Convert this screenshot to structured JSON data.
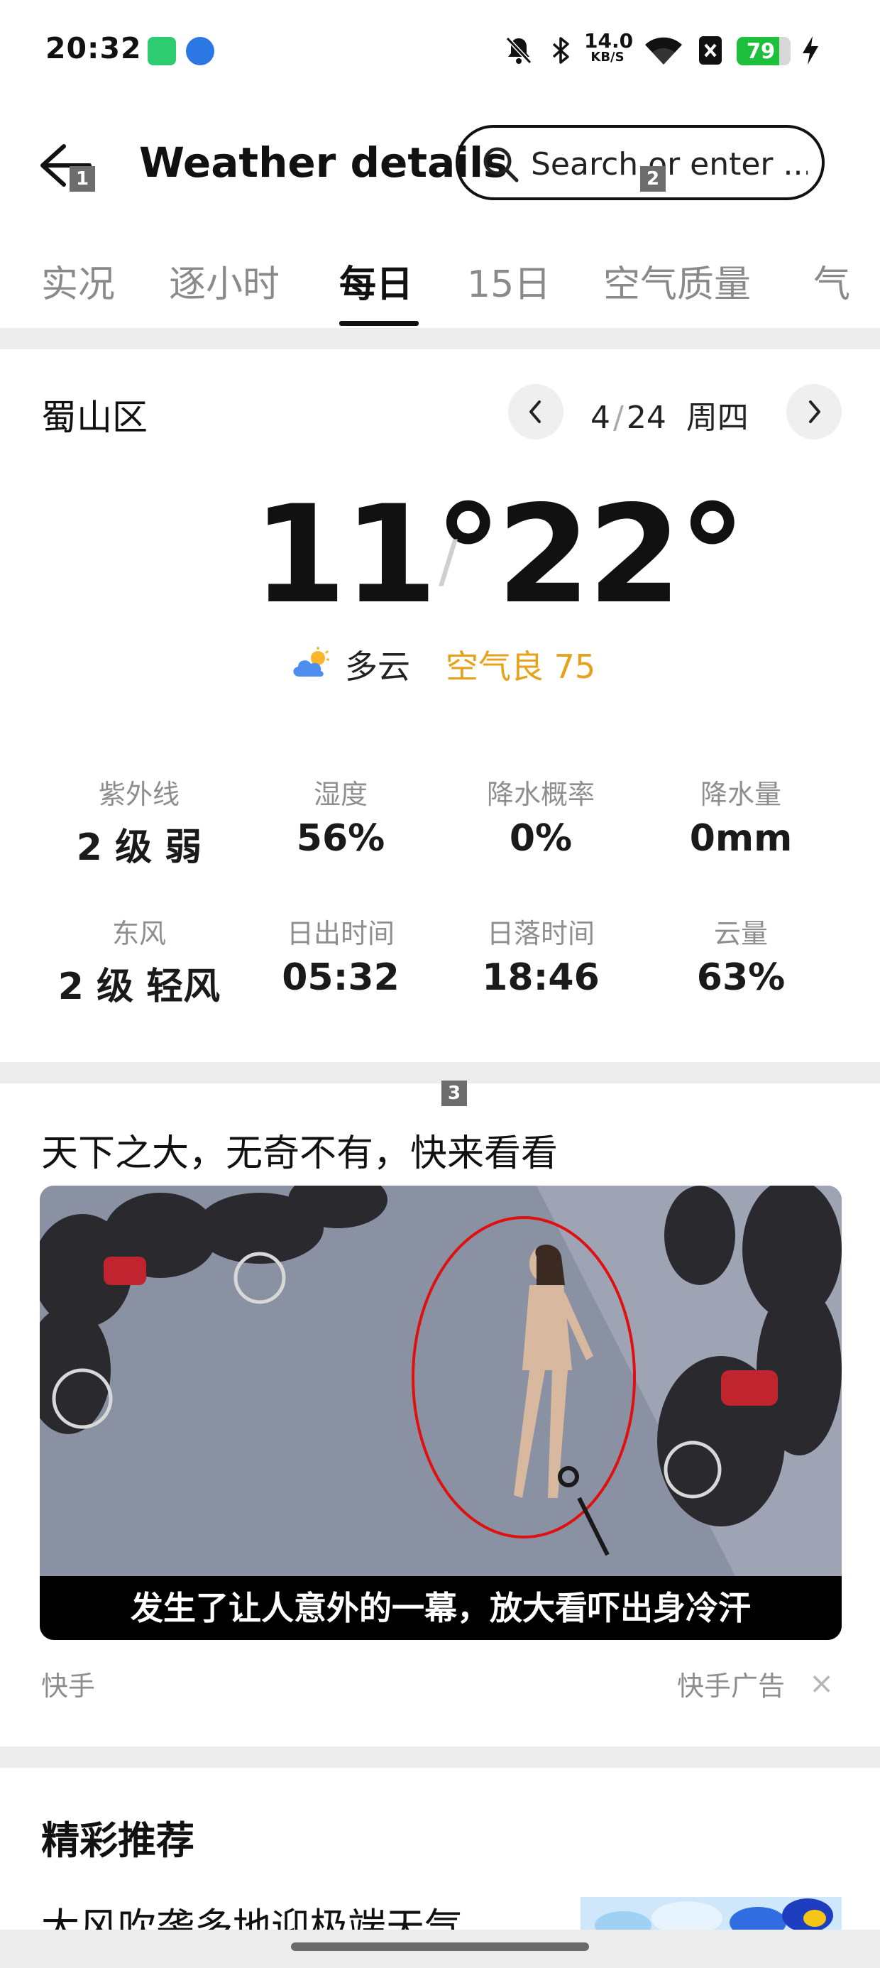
{
  "status_bar": {
    "time": "20:32",
    "net_speed_value": "14.0",
    "net_speed_unit": "KB/S",
    "battery_level": 79,
    "battery_text": "79",
    "icons": [
      "battery-saver-app-icon",
      "app-notification-icon",
      "bell-muted-icon",
      "bluetooth-icon",
      "wifi-icon",
      "sim-blocked-icon",
      "charging-icon"
    ]
  },
  "app_bar": {
    "title": "Weather details",
    "search_placeholder": "Search or enter ...",
    "badges": [
      "1",
      "2",
      "3"
    ]
  },
  "tabs": [
    {
      "label": "实况",
      "active": false
    },
    {
      "label": "逐小时",
      "active": false
    },
    {
      "label": "每日",
      "active": true
    },
    {
      "label": "15日",
      "active": false
    },
    {
      "label": "空气质量",
      "active": false
    },
    {
      "label": "气",
      "active": false
    }
  ],
  "weather": {
    "district": "蜀山区",
    "date_month": "4",
    "date_day": "24",
    "weekday": "周四",
    "temp_low": "11°",
    "temp_high": "22°",
    "temp_separator": "/",
    "condition": "多云",
    "air_quality": "空气良 75",
    "metrics": [
      {
        "label": "紫外线",
        "value": "2 级 弱"
      },
      {
        "label": "湿度",
        "value": "56%"
      },
      {
        "label": "降水概率",
        "value": "0%"
      },
      {
        "label": "降水量",
        "value": "0mm"
      },
      {
        "label": "东风",
        "value": "2 级 轻风"
      },
      {
        "label": "日出时间",
        "value": "05:32"
      },
      {
        "label": "日落时间",
        "value": "18:46"
      },
      {
        "label": "云量",
        "value": "63%"
      }
    ]
  },
  "ad": {
    "headline": "天下之大，无奇不有，快来看看",
    "caption": "发生了让人意外的一幕，放大看吓出身冷汗",
    "source": "快手",
    "label": "快手广告",
    "close": "×"
  },
  "recommended": {
    "title": "精彩推荐",
    "item_title": "大风吹袭多地迎极端天气..."
  },
  "colors": {
    "accent_air": "#e6a21a",
    "battery_green": "#1fbf3e",
    "ad_circle": "#e01010"
  }
}
